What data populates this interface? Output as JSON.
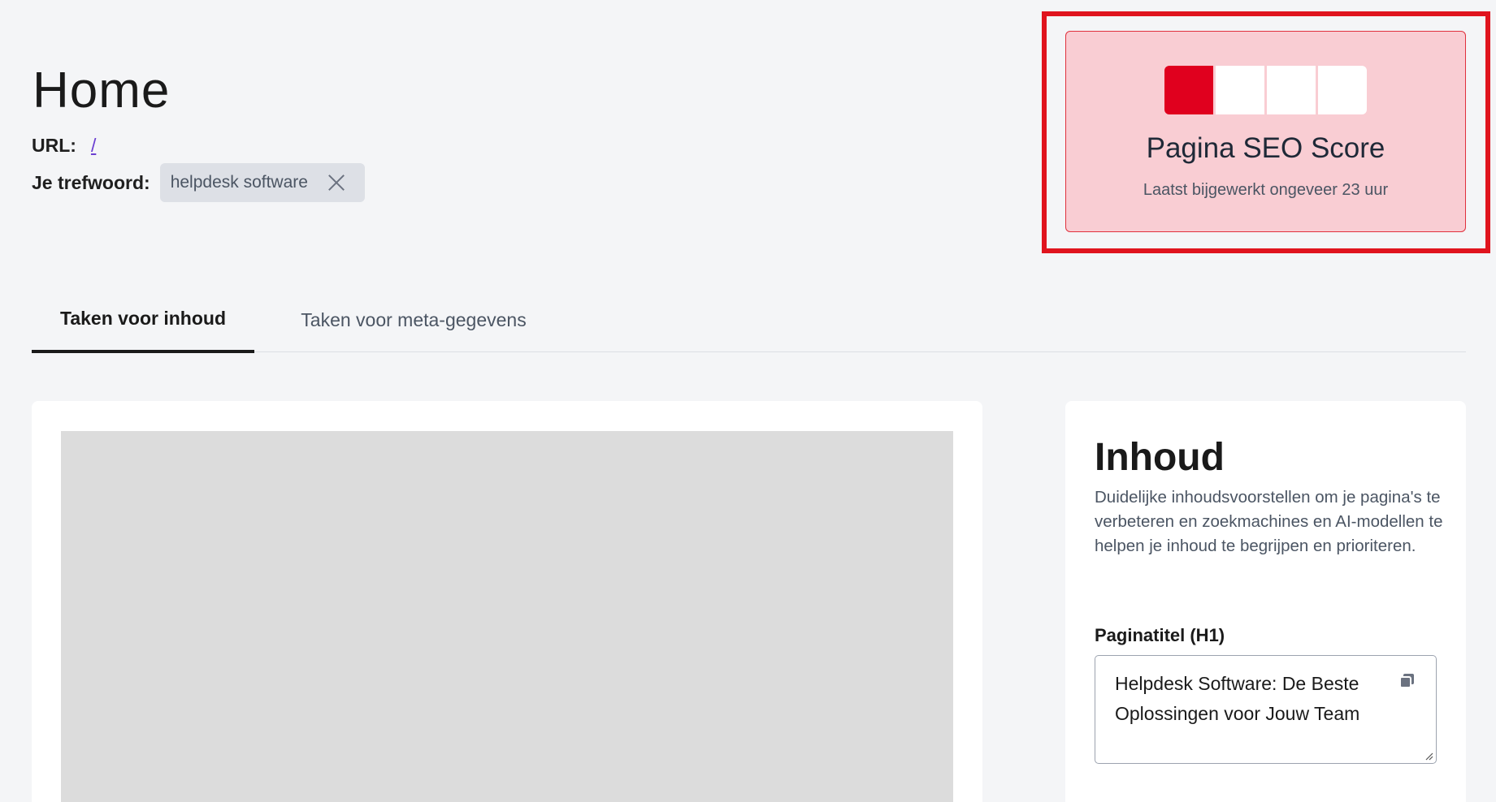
{
  "header": {
    "title": "Home",
    "url_label": "URL:",
    "url_value": "/",
    "keyword_label": "Je trefwoord:",
    "keyword_value": "helpdesk software"
  },
  "seo_score": {
    "title": "Pagina SEO Score",
    "updated": "Laatst bijgewerkt ongeveer 23 uur",
    "filled_segments": 1,
    "total_segments": 4,
    "color_filled": "#e0001e",
    "card_bg": "#f9cdd3"
  },
  "tabs": [
    {
      "label": "Taken voor inhoud",
      "active": true
    },
    {
      "label": "Taken voor meta-gegevens",
      "active": false
    }
  ],
  "content_panel": {
    "title": "Inhoud",
    "description": "Duidelijke inhoudsvoorstellen om je pagina's te verbeteren en zoekmachines en AI-modellen te helpen je inhoud te begrijpen en prioriteren.",
    "h1_label": "Paginatitel (H1)",
    "h1_value": "Helpdesk Software: De Beste Oplossingen voor Jouw Team",
    "copy_icon": "copy-icon"
  }
}
